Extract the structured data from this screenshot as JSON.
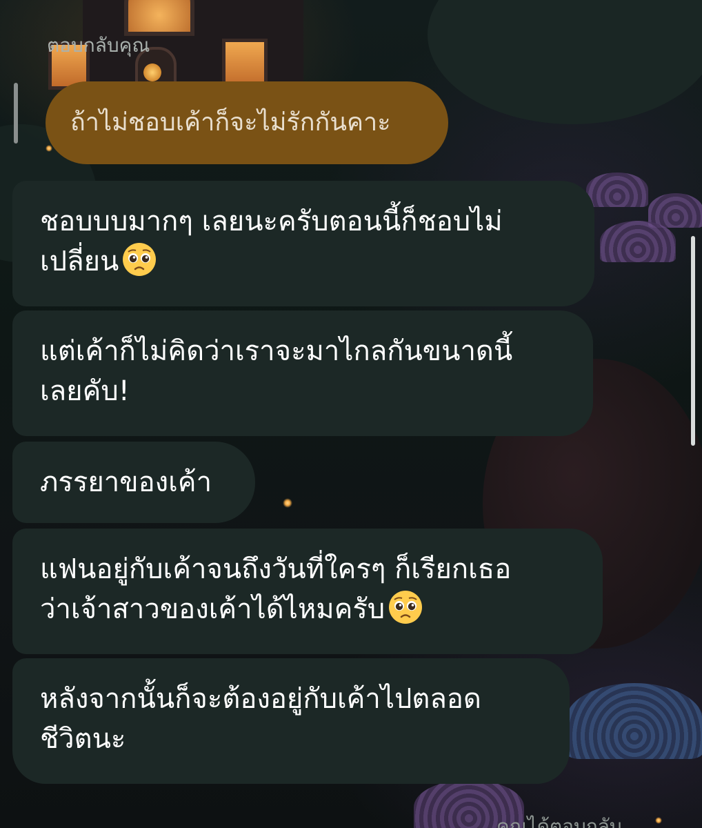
{
  "reply": {
    "label": "ตอบกลับคุณ",
    "quoted_text": "ถ้าไม่ชอบเค้าก็จะไม่รักกันคาะ"
  },
  "messages": [
    {
      "lines": [
        "ชอบบบมากๆ เลยนะครับตอนนี้ก็ชอบไม่",
        "เปลี่ยน"
      ],
      "emoji": "pleading-face"
    },
    {
      "lines": [
        "แต่เค้าก็ไม่คิดว่าเราจะมาไกลกันขนาดนี้",
        "เลยคับ!"
      ]
    },
    {
      "lines": [
        "ภรรยาของเค้า"
      ]
    },
    {
      "lines": [
        "แฟนอยู่กับเค้าจนถึงวันที่ใครๆ ก็เรียกเธอ",
        "ว่าเจ้าสาวของเค้าได้ไหมครับ"
      ],
      "emoji": "pleading-face"
    },
    {
      "lines": [
        "หลังจากนั้นก็จะต้องอยู่กับเค้าไปตลอด",
        "ชีวิตนะ"
      ]
    }
  ],
  "footer": {
    "hint_text": "คุณได้ตอบกลับ"
  },
  "colors": {
    "reply_bubble": "#7a5215",
    "message_bubble": "#1c2826",
    "background": "#0c1411"
  }
}
